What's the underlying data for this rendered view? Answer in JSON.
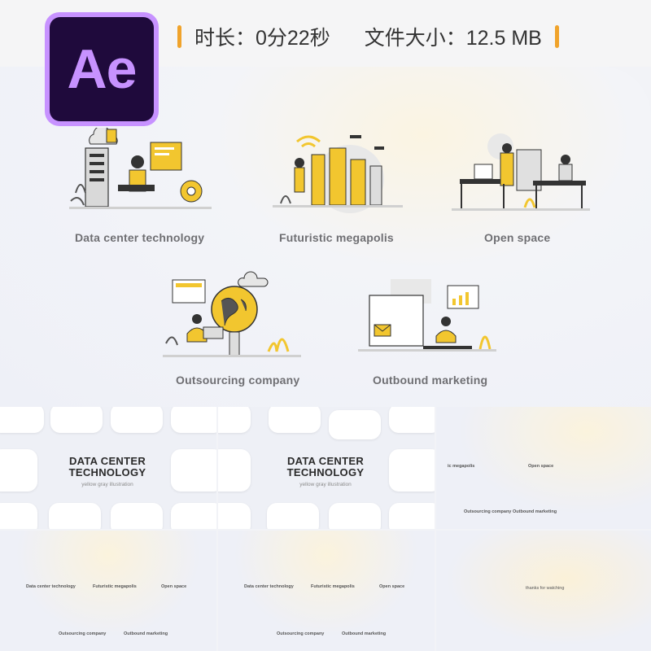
{
  "app": {
    "logo_text": "Ae"
  },
  "header": {
    "duration_label": "时长：0分22秒",
    "size_label": "文件大小：12.5 MB",
    "accent_color": "#f0a32b"
  },
  "preview": {
    "scenes": [
      {
        "label": "Data center technology"
      },
      {
        "label": "Futuristic megapolis"
      },
      {
        "label": "Open space"
      },
      {
        "label": "Outsourcing company"
      },
      {
        "label": "Outbound marketing"
      }
    ]
  },
  "thumbnails": {
    "title_line1": "DATA CENTER",
    "title_line2": "TECHNOLOGY",
    "subtitle": "yellow gray illustration",
    "frame3_labels": [
      "ic megapolis",
      "Open space",
      "Outsourcing company",
      "Outbound marketing"
    ],
    "frame45_labels": [
      "Data center technology",
      "Futuristic megapolis",
      "Open space",
      "Outsourcing company",
      "Outbound marketing"
    ],
    "end_text": "thanks for watching"
  },
  "colors": {
    "yellow": "#f2c62f",
    "gray": "#9a9a9a",
    "dark": "#2b2b2b"
  }
}
